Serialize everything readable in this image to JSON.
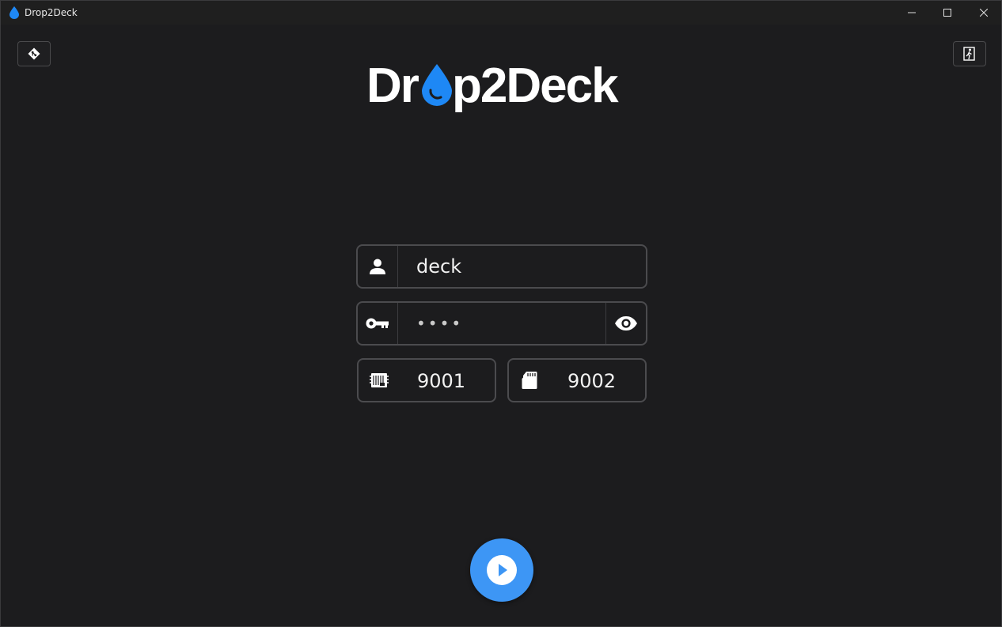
{
  "window": {
    "title": "Drop2Deck",
    "controls": {
      "minimize": "minimize-icon",
      "maximize": "maximize-icon",
      "close": "close-icon"
    }
  },
  "toolbar": {
    "left_icon": "git-icon",
    "right_icon": "exit-icon"
  },
  "logo": {
    "text_before": "Dr",
    "text_after": "p2Deck",
    "accent_color": "#1e88f5"
  },
  "form": {
    "username": {
      "icon": "user-icon",
      "value": "deck"
    },
    "password": {
      "icon": "key-icon",
      "value": "••••",
      "toggle_icon": "eye-icon"
    },
    "port_cpu": {
      "icon": "cpu-icon",
      "value": "9001"
    },
    "port_storage": {
      "icon": "sd-card-icon",
      "value": "9002"
    }
  },
  "action": {
    "icon": "play-icon",
    "color": "#3d96f5"
  }
}
